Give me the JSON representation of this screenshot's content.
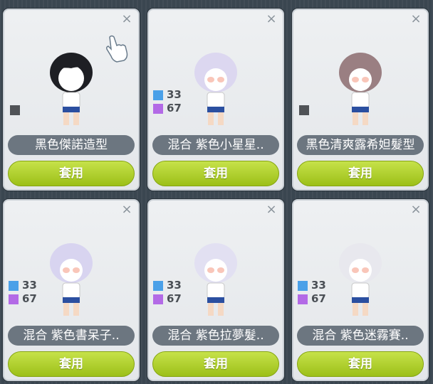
{
  "cards": [
    {
      "name": "黑色傑諾造型",
      "apply": "套用",
      "close": "×",
      "stats": [],
      "hair": "#1e1f24",
      "swatch": "dark"
    },
    {
      "name": "混合 紫色小星星..",
      "apply": "套用",
      "close": "×",
      "stats": [
        "33",
        "67"
      ],
      "hair": "#dcd7f0"
    },
    {
      "name": "黑色清爽露希妲髮型",
      "apply": "套用",
      "close": "×",
      "stats": [],
      "hair": "#9a7f82",
      "swatch": "dark"
    },
    {
      "name": "混合 紫色書呆子..",
      "apply": "套用",
      "close": "×",
      "stats": [
        "33",
        "67"
      ],
      "hair": "#d8d4f0"
    },
    {
      "name": "混合 紫色拉夢髮..",
      "apply": "套用",
      "close": "×",
      "stats": [
        "33",
        "67"
      ],
      "hair": "#e2e0f2"
    },
    {
      "name": "混合 紫色迷霧賽..",
      "apply": "套用",
      "close": "×",
      "stats": [
        "33",
        "67"
      ],
      "hair": "#e8e8ee"
    }
  ],
  "colors": {
    "blue": "#4aa0e8",
    "purple": "#b36ae6",
    "apply_green": "#9cc018"
  }
}
